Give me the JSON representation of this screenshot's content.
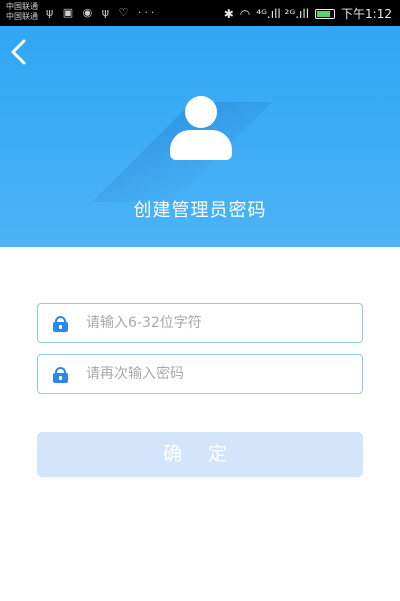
{
  "status_bar": {
    "carrier_line1": "中国联通",
    "carrier_line2": "中国联通",
    "left_icons": "ψ ▣ ◉ ψ ♡ ···",
    "signal": "⁴ᴳ.ıll ²ᴳ.ıll",
    "time": "下午1:12",
    "battery_level": 0.8
  },
  "header": {
    "title": "创建管理员密码",
    "accent_color": "#2fa6f5"
  },
  "form": {
    "password_placeholder": "请输入6-32位字符",
    "confirm_placeholder": "请再次输入密码",
    "submit_label": "确 定"
  }
}
